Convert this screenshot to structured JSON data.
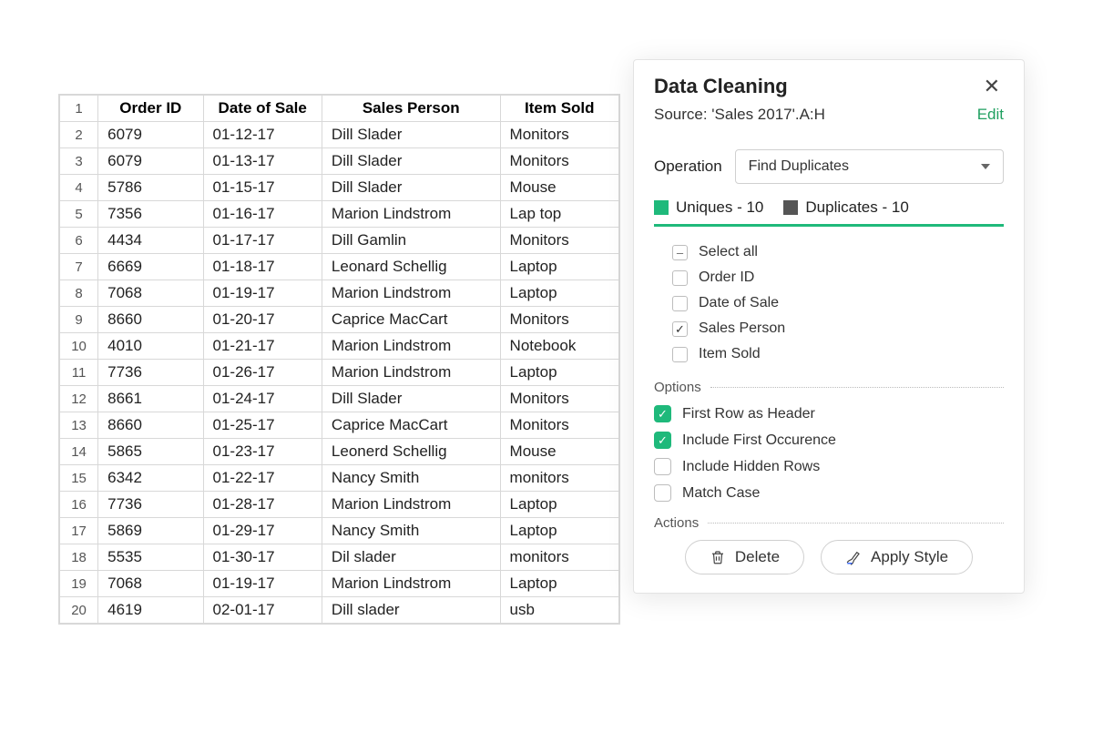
{
  "table": {
    "headers": [
      "Order ID",
      "Date of Sale",
      "Sales Person",
      "Item Sold"
    ],
    "rows": [
      {
        "n": 1
      },
      {
        "n": 2,
        "cols": [
          "6079",
          "01-12-17",
          "Dill Slader",
          "Monitors"
        ]
      },
      {
        "n": 3,
        "cols": [
          "6079",
          "01-13-17",
          "Dill Slader",
          "Monitors"
        ]
      },
      {
        "n": 4,
        "cols": [
          "5786",
          "01-15-17",
          "Dill Slader",
          "Mouse"
        ]
      },
      {
        "n": 5,
        "cols": [
          "7356",
          "01-16-17",
          "Marion Lindstrom",
          "Lap top"
        ]
      },
      {
        "n": 6,
        "cols": [
          "4434",
          "01-17-17",
          "Dill Gamlin",
          "Monitors"
        ]
      },
      {
        "n": 7,
        "cols": [
          "6669",
          "01-18-17",
          "Leonard Schellig",
          "Laptop"
        ]
      },
      {
        "n": 8,
        "cols": [
          "7068",
          "01-19-17",
          "Marion Lindstrom",
          "Laptop"
        ]
      },
      {
        "n": 9,
        "cols": [
          "8660",
          "01-20-17",
          "Caprice MacCart",
          "Monitors"
        ]
      },
      {
        "n": 10,
        "cols": [
          "4010",
          "01-21-17",
          "Marion Lindstrom",
          "Notebook"
        ]
      },
      {
        "n": 11,
        "cols": [
          "7736",
          "01-26-17",
          "Marion Lindstrom",
          "Laptop"
        ]
      },
      {
        "n": 12,
        "cols": [
          "8661",
          "01-24-17",
          "Dill Slader",
          "Monitors"
        ]
      },
      {
        "n": 13,
        "cols": [
          "8660",
          "01-25-17",
          "Caprice MacCart",
          "Monitors"
        ]
      },
      {
        "n": 14,
        "cols": [
          "5865",
          "01-23-17",
          "Leonerd Schellig",
          "Mouse"
        ]
      },
      {
        "n": 15,
        "cols": [
          "6342",
          "01-22-17",
          "Nancy Smith",
          "monitors"
        ]
      },
      {
        "n": 16,
        "cols": [
          "7736",
          "01-28-17",
          "Marion Lindstrom",
          "Laptop"
        ]
      },
      {
        "n": 17,
        "cols": [
          "5869",
          "01-29-17",
          "Nancy Smith",
          "Laptop"
        ]
      },
      {
        "n": 18,
        "cols": [
          "5535",
          "01-30-17",
          "Dil slader",
          "monitors"
        ]
      },
      {
        "n": 19,
        "cols": [
          "7068",
          "01-19-17",
          "Marion Lindstrom",
          "Laptop"
        ]
      },
      {
        "n": 20,
        "cols": [
          "4619",
          "02-01-17",
          "Dill slader",
          "usb"
        ]
      }
    ]
  },
  "panel": {
    "title": "Data Cleaning",
    "source": "Source: 'Sales 2017'.A:H",
    "edit": "Edit",
    "operation_label": "Operation",
    "operation_value": "Find  Duplicates",
    "legend": {
      "uniques": "Uniques - 10",
      "duplicates": "Duplicates - 10"
    },
    "columns": [
      {
        "label": "Select all",
        "state": "indet"
      },
      {
        "label": "Order ID",
        "state": "off"
      },
      {
        "label": "Date of Sale",
        "state": "off"
      },
      {
        "label": "Sales Person",
        "state": "on"
      },
      {
        "label": "Item Sold",
        "state": "off"
      }
    ],
    "options_label": "Options",
    "options": [
      {
        "label": "First Row as Header",
        "on": true
      },
      {
        "label": "Include First Occurence",
        "on": true
      },
      {
        "label": "Include Hidden Rows",
        "on": false
      },
      {
        "label": "Match Case",
        "on": false
      }
    ],
    "actions_label": "Actions",
    "delete_label": "Delete",
    "apply_style_label": "Apply Style"
  }
}
